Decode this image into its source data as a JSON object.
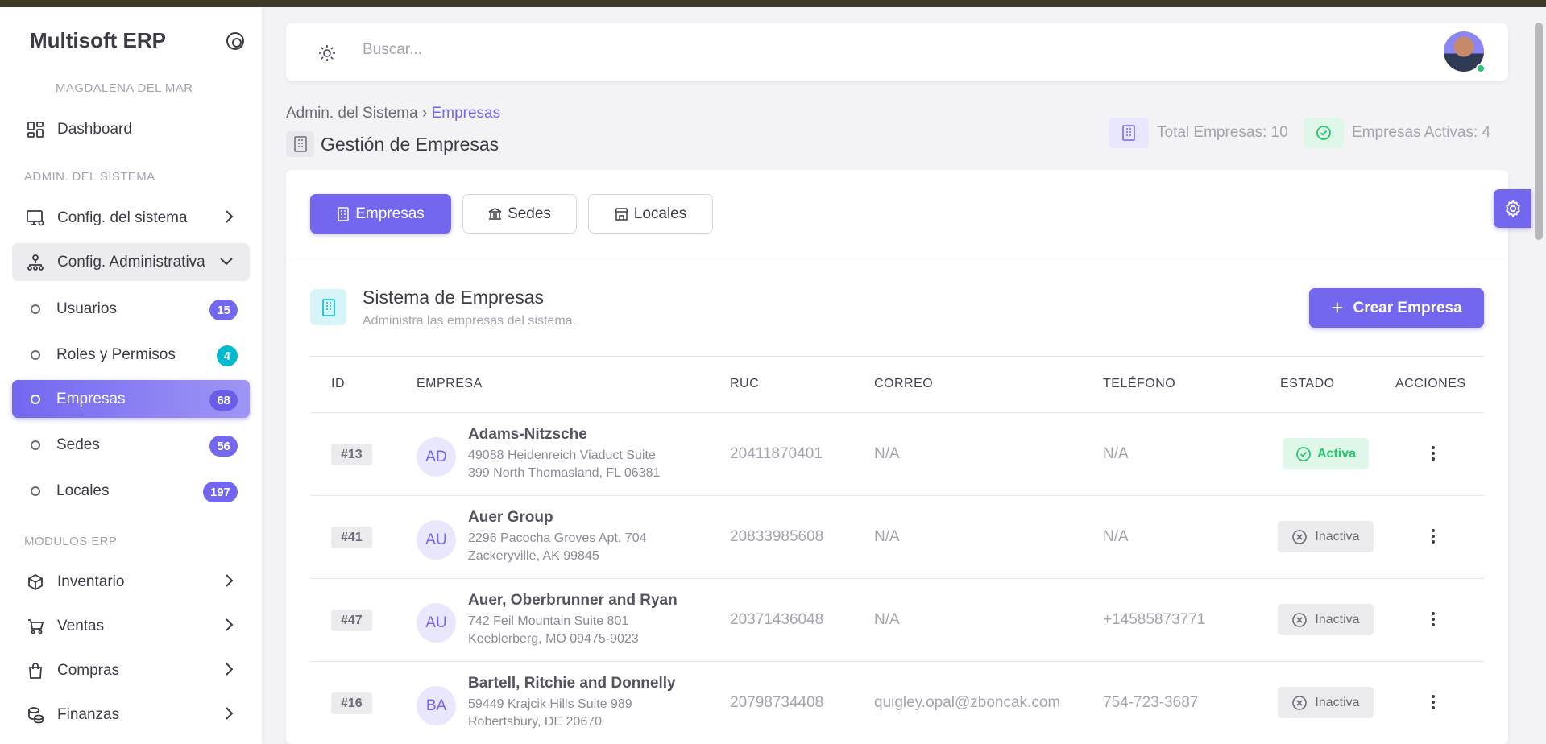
{
  "sidebar": {
    "brand": "Multisoft ERP",
    "company": "MAGDALENA DEL MAR",
    "dashboard": "Dashboard",
    "section_admin": "ADMIN. DEL SISTEMA",
    "config_sistema": "Config. del sistema",
    "config_admin": "Config. Administrativa",
    "sub": [
      {
        "label": "Usuarios",
        "badge": "15"
      },
      {
        "label": "Roles y Permisos",
        "badge": "4"
      },
      {
        "label": "Empresas",
        "badge": "68"
      },
      {
        "label": "Sedes",
        "badge": "56"
      },
      {
        "label": "Locales",
        "badge": "197"
      }
    ],
    "section_modules": "MÓDULOS ERP",
    "modules": [
      "Inventario",
      "Ventas",
      "Compras",
      "Finanzas"
    ]
  },
  "topbar": {
    "search_placeholder": "Buscar..."
  },
  "breadcrumb": {
    "parent": "Admin. del Sistema",
    "sep": "›",
    "current": "Empresas"
  },
  "page_title": "Gestión de Empresas",
  "stats": {
    "total": "Total Empresas: 10",
    "active": "Empresas Activas: 4"
  },
  "tabs": [
    "Empresas",
    "Sedes",
    "Locales"
  ],
  "section": {
    "title": "Sistema de Empresas",
    "subtitle": "Administra las empresas del sistema.",
    "create_label": "Crear Empresa"
  },
  "table": {
    "headers": [
      "ID",
      "EMPRESA",
      "RUC",
      "CORREO",
      "TELÉFONO",
      "ESTADO",
      "ACCIONES"
    ],
    "rows": [
      {
        "id": "#13",
        "initials": "AD",
        "name": "Adams-Nitzsche",
        "addr1": "49088 Heidenreich Viaduct Suite",
        "addr2": "399 North Thomasland, FL 06381",
        "ruc": "20411870401",
        "email": "N/A",
        "phone": "N/A",
        "status": "Activa"
      },
      {
        "id": "#41",
        "initials": "AU",
        "name": "Auer Group",
        "addr1": "2296 Pacocha Groves Apt. 704",
        "addr2": "Zackeryville, AK 99845",
        "ruc": "20833985608",
        "email": "N/A",
        "phone": "N/A",
        "status": "Inactiva"
      },
      {
        "id": "#47",
        "initials": "AU",
        "name": "Auer, Oberbrunner and Ryan",
        "addr1": "742 Feil Mountain Suite 801",
        "addr2": "Keeblerberg, MO 09475-9023",
        "ruc": "20371436048",
        "email": "N/A",
        "phone": "+14585873771",
        "status": "Inactiva"
      },
      {
        "id": "#16",
        "initials": "BA",
        "name": "Bartell, Ritchie and Donnelly",
        "addr1": "59449 Krajcik Hills Suite 989",
        "addr2": "Robertsbury, DE 20670",
        "ruc": "20798734408",
        "email": "quigley.opal@zboncak.com",
        "phone": "754-723-3687",
        "status": "Inactiva"
      }
    ]
  },
  "colors": {
    "primary": "#7367f0",
    "success": "#28c76f",
    "cyan": "#00bad1"
  }
}
